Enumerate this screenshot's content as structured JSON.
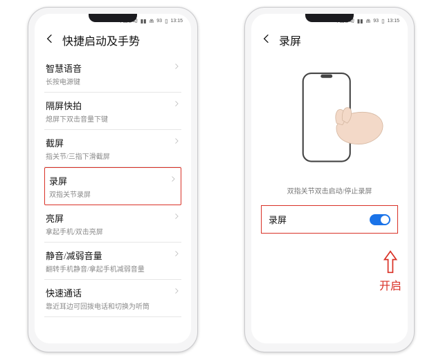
{
  "statusbar": {
    "carrier": "中国移动",
    "battery": "93",
    "time": "13:15"
  },
  "left": {
    "title": "快捷启动及手势",
    "items": [
      {
        "title": "智慧语音",
        "subtitle": "长按电源键"
      },
      {
        "title": "隔屏快拍",
        "subtitle": "熄屏下双击音量下键"
      },
      {
        "title": "截屏",
        "subtitle": "指关节/三指下滑截屏"
      },
      {
        "title": "录屏",
        "subtitle": "双指关节录屏"
      },
      {
        "title": "亮屏",
        "subtitle": "拿起手机/双击亮屏"
      },
      {
        "title": "静音/减弱音量",
        "subtitle": "翻转手机静音/拿起手机减弱音量"
      },
      {
        "title": "快速通话",
        "subtitle": "靠近耳边可回拨电话和切换为听筒"
      }
    ],
    "highlight_index": 3
  },
  "right": {
    "title": "录屏",
    "caption": "双指关节双击启动/停止录屏",
    "toggle": {
      "label": "录屏",
      "on": true
    }
  },
  "annotation": {
    "label": "开启"
  }
}
